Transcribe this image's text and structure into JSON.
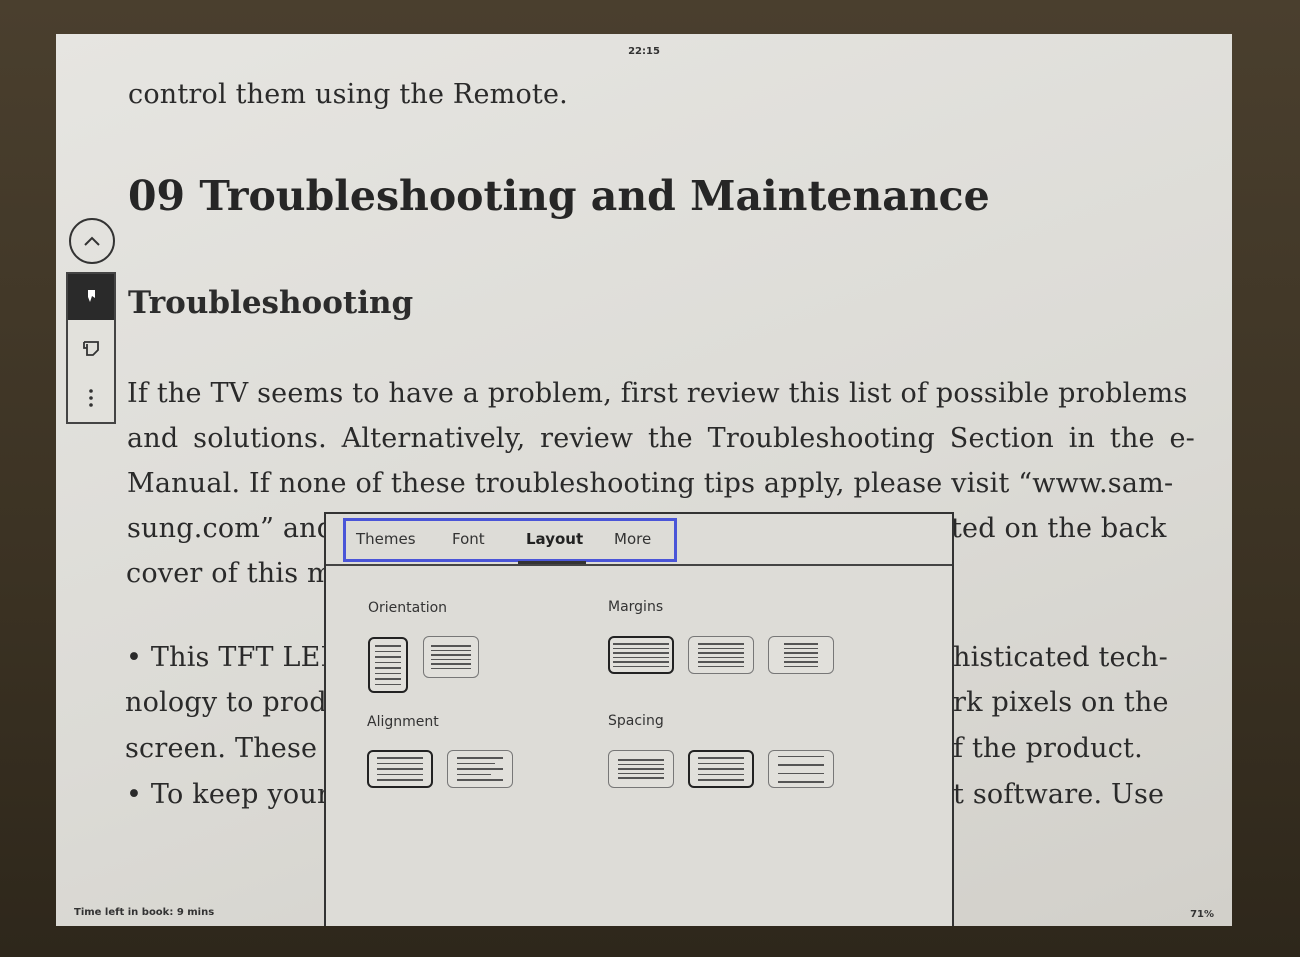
{
  "status": {
    "clock": "22:15",
    "time_left": "Time left in book: 9 mins",
    "progress": "71%"
  },
  "reader": {
    "line_0": "control them using the Remote.",
    "chapter_title": "09 Troubleshooting and Maintenance",
    "section_title": "Troubleshooting",
    "para1_lines": [
      "If the TV seems to have a problem, first review this list of possible problems",
      "and solutions. Alternatively, review the Troubleshooting Section in the e-",
      "Manual. If none of these troubleshooting tips apply, please visit “www.sam-",
      "sung.com” and",
      "ted on the back",
      "cover of this m"
    ],
    "bullet_lines": [
      "• This TFT LED",
      "nology to prod",
      "screen. These p",
      "• To keep your",
      "histicated tech-",
      "rk pixels on the",
      "f the product.",
      "t software. Use"
    ]
  },
  "toolbar": {
    "up": "chevron-up-icon",
    "bookmark": "bookmark-icon",
    "notes": "notes-icon",
    "more": "more-vertical-icon"
  },
  "settings": {
    "tabs": [
      "Themes",
      "Font",
      "Layout",
      "More"
    ],
    "active_tab": "Layout",
    "orientation_label": "Orientation",
    "margins_label": "Margins",
    "alignment_label": "Alignment",
    "spacing_label": "Spacing"
  },
  "colors": {
    "highlight": "#4a55d8",
    "screen": "#dedcd7"
  }
}
